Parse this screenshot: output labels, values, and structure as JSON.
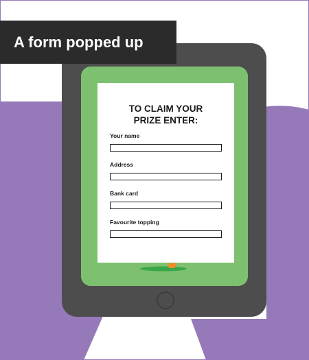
{
  "caption": {
    "text": "A form popped up"
  },
  "form": {
    "title": "TO CLAIM YOUR\nPRIZE ENTER:",
    "fields": [
      {
        "label": "Your name",
        "value": ""
      },
      {
        "label": "Address",
        "value": ""
      },
      {
        "label": "Bank card",
        "value": ""
      },
      {
        "label": "Favourite topping",
        "value": ""
      }
    ]
  },
  "colors": {
    "purple_background": "#9679b8",
    "tablet_body": "#4d4d4d",
    "tablet_screen": "#7dc170",
    "caption_background": "#2b2b2b",
    "form_background": "#ffffff"
  },
  "icons": {
    "home_button": "circle-outline",
    "device": "tablet"
  }
}
